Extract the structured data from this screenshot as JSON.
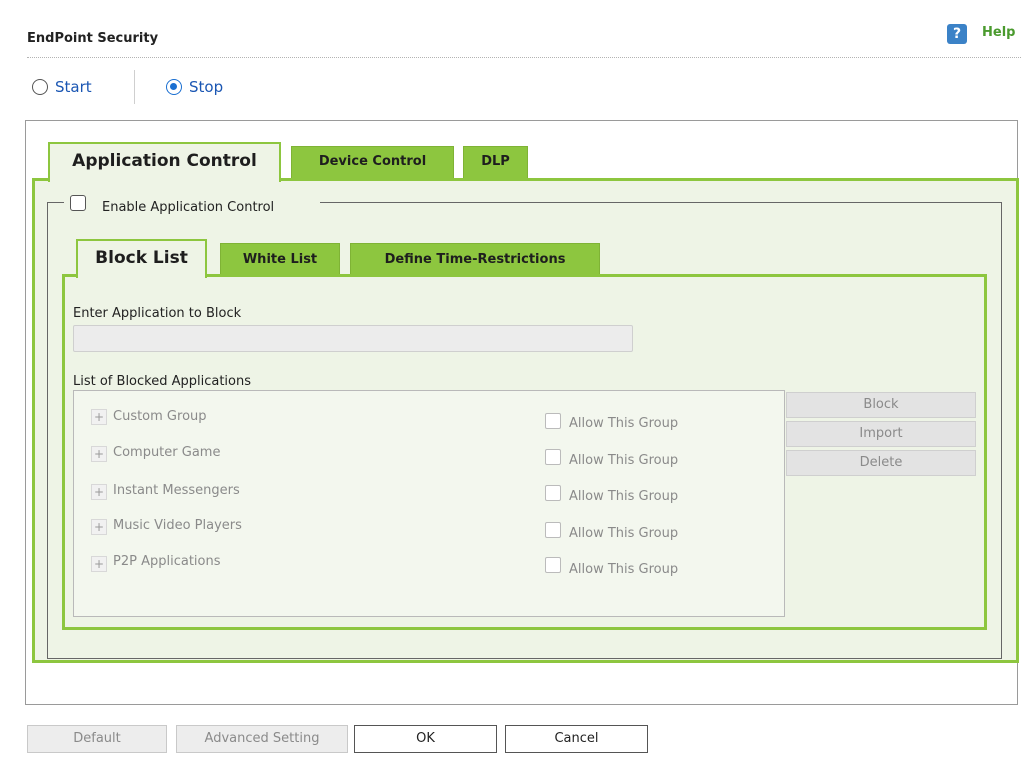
{
  "header": {
    "title": "EndPoint Security",
    "help_icon": "?",
    "help_label": "Help"
  },
  "service": {
    "start_label": "Start",
    "stop_label": "Stop",
    "selected": "Stop"
  },
  "tabs": [
    {
      "label": "Application Control",
      "active": true
    },
    {
      "label": "Device Control",
      "active": false
    },
    {
      "label": "DLP",
      "active": false
    }
  ],
  "app_control": {
    "enable_label": "Enable Application Control",
    "enabled": false,
    "subtabs": [
      {
        "label": "Block List",
        "active": true
      },
      {
        "label": "White List",
        "active": false
      },
      {
        "label": "Define Time-Restrictions",
        "active": false
      }
    ],
    "enter_label": "Enter Application to Block",
    "enter_value": "",
    "list_label": "List of Blocked Applications",
    "groups": [
      {
        "name": "Custom Group",
        "allow_label": "Allow This Group",
        "allowed": false
      },
      {
        "name": "Computer Game",
        "allow_label": "Allow This Group",
        "allowed": false
      },
      {
        "name": "Instant Messengers",
        "allow_label": "Allow This Group",
        "allowed": false
      },
      {
        "name": "Music Video Players",
        "allow_label": "Allow This Group",
        "allowed": false
      },
      {
        "name": "P2P Applications",
        "allow_label": "Allow This Group",
        "allowed": false
      }
    ],
    "expand_glyph": "+",
    "buttons": {
      "block": "Block",
      "import": "Import",
      "delete": "Delete"
    }
  },
  "footer": {
    "default": "Default",
    "advanced": "Advanced Setting",
    "ok": "OK",
    "cancel": "Cancel"
  },
  "colors": {
    "tab_green": "#8dc63f",
    "panel_bg": "#eef4e6",
    "link_blue": "#1a56b3",
    "help_green": "#4a9a2e"
  }
}
